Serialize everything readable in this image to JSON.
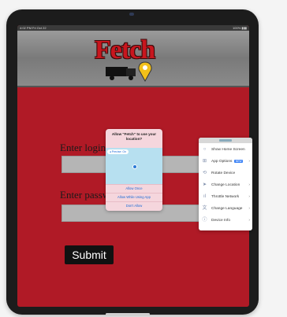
{
  "status": {
    "time": "4:02 PM   Fri Oct 22",
    "battery": "100% ▮▮▮"
  },
  "app": {
    "logo_text": "Fetch"
  },
  "form": {
    "login_label": "Enter login",
    "password_label": "Enter passwo",
    "submit_label": "Submit"
  },
  "alert": {
    "title": "Allow \"Fetch\" to use your location?",
    "precise": "◂ Precise: On",
    "once": "Allow Once",
    "while_using": "Allow While Using App",
    "dont_allow": "Don't Allow"
  },
  "side_menu": {
    "items": [
      {
        "label": "Show Home Screen",
        "icon": "○",
        "chevron": ""
      },
      {
        "label": "App Options",
        "icon": "⊞",
        "chevron": "›",
        "badge": "NEW"
      },
      {
        "label": "Rotate Device",
        "icon": "⟲",
        "chevron": ""
      },
      {
        "label": "Change Location",
        "icon": "➤",
        "chevron": "›"
      },
      {
        "label": "Throttle Network",
        "icon": "ıl",
        "chevron": "›"
      },
      {
        "label": "Change Language",
        "icon": "文",
        "chevron": "›"
      },
      {
        "label": "Device Info",
        "icon": "ⓘ",
        "chevron": "›"
      }
    ]
  }
}
